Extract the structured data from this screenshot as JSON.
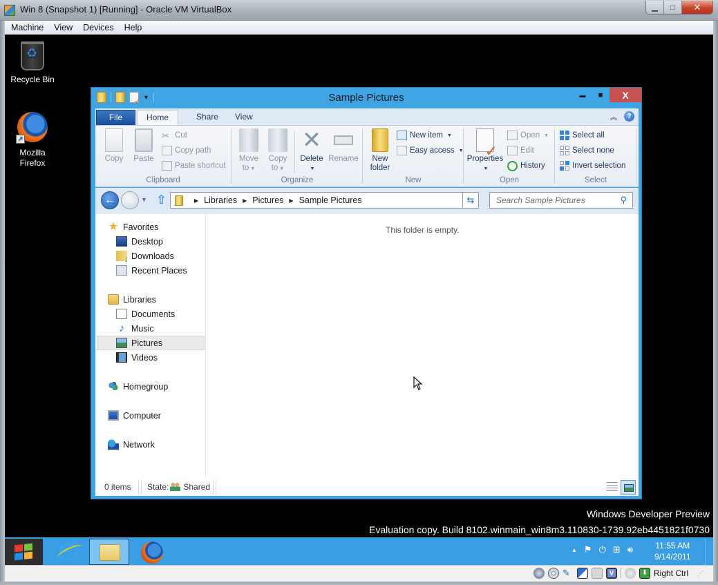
{
  "host_window": {
    "title": "Win 8 (Snapshot 1) [Running] - Oracle VM VirtualBox",
    "menu": [
      "Machine",
      "View",
      "Devices",
      "Help"
    ],
    "controls": {
      "minimize": "▁",
      "maximize": "□",
      "close": "✕"
    },
    "status_bar": {
      "host_key_label": "Right Ctrl"
    }
  },
  "desktop": {
    "icons": [
      {
        "label": "Recycle Bin",
        "icon": "recycle-bin-icon"
      },
      {
        "label": "Mozilla Firefox",
        "icon": "firefox-icon"
      }
    ],
    "watermark": {
      "line1": "Windows Developer Preview",
      "line2": "Evaluation copy. Build 8102.winmain_win8m3.110830-1739.92eb4451821f0730"
    }
  },
  "explorer": {
    "title": "Sample Pictures",
    "controls": {
      "minimize": "▬",
      "maximize": "■",
      "close": "X"
    },
    "tabs": {
      "file": "File",
      "home": "Home",
      "share": "Share",
      "view": "View"
    },
    "active_tab": "Home",
    "ribbon": {
      "clipboard": {
        "label": "Clipboard",
        "copy": "Copy",
        "paste": "Paste",
        "cut": "Cut",
        "copy_path": "Copy path",
        "paste_shortcut": "Paste shortcut"
      },
      "organize": {
        "label": "Organize",
        "move_to_1": "Move",
        "move_to_2": "to",
        "copy_to_1": "Copy",
        "copy_to_2": "to",
        "delete": "Delete",
        "rename": "Rename"
      },
      "new": {
        "label": "New",
        "new_folder_1": "New",
        "new_folder_2": "folder",
        "new_item": "New item",
        "easy_access": "Easy access"
      },
      "open": {
        "label": "Open",
        "properties": "Properties",
        "open": "Open",
        "edit": "Edit",
        "history": "History"
      },
      "select": {
        "label": "Select",
        "select_all": "Select all",
        "select_none": "Select none",
        "invert_selection": "Invert selection"
      }
    },
    "address": {
      "breadcrumb": [
        "Libraries",
        "Pictures",
        "Sample Pictures"
      ],
      "search_placeholder": "Search Sample Pictures"
    },
    "nav_pane": {
      "favorites": {
        "label": "Favorites",
        "items": [
          "Desktop",
          "Downloads",
          "Recent Places"
        ]
      },
      "libraries": {
        "label": "Libraries",
        "items": [
          "Documents",
          "Music",
          "Pictures",
          "Videos"
        ]
      },
      "selected": "Pictures",
      "homegroup": "Homegroup",
      "computer": "Computer",
      "network": "Network"
    },
    "content": {
      "empty_message": "This folder is empty."
    },
    "status": {
      "item_count": "0 items",
      "state_label": "State:",
      "state_value": "Shared"
    }
  },
  "taskbar": {
    "pinned": [
      "Internet Explorer",
      "File Explorer",
      "Mozilla Firefox"
    ],
    "active": "File Explorer",
    "clock": {
      "time": "11:55 AM",
      "date": "9/14/2011"
    }
  }
}
